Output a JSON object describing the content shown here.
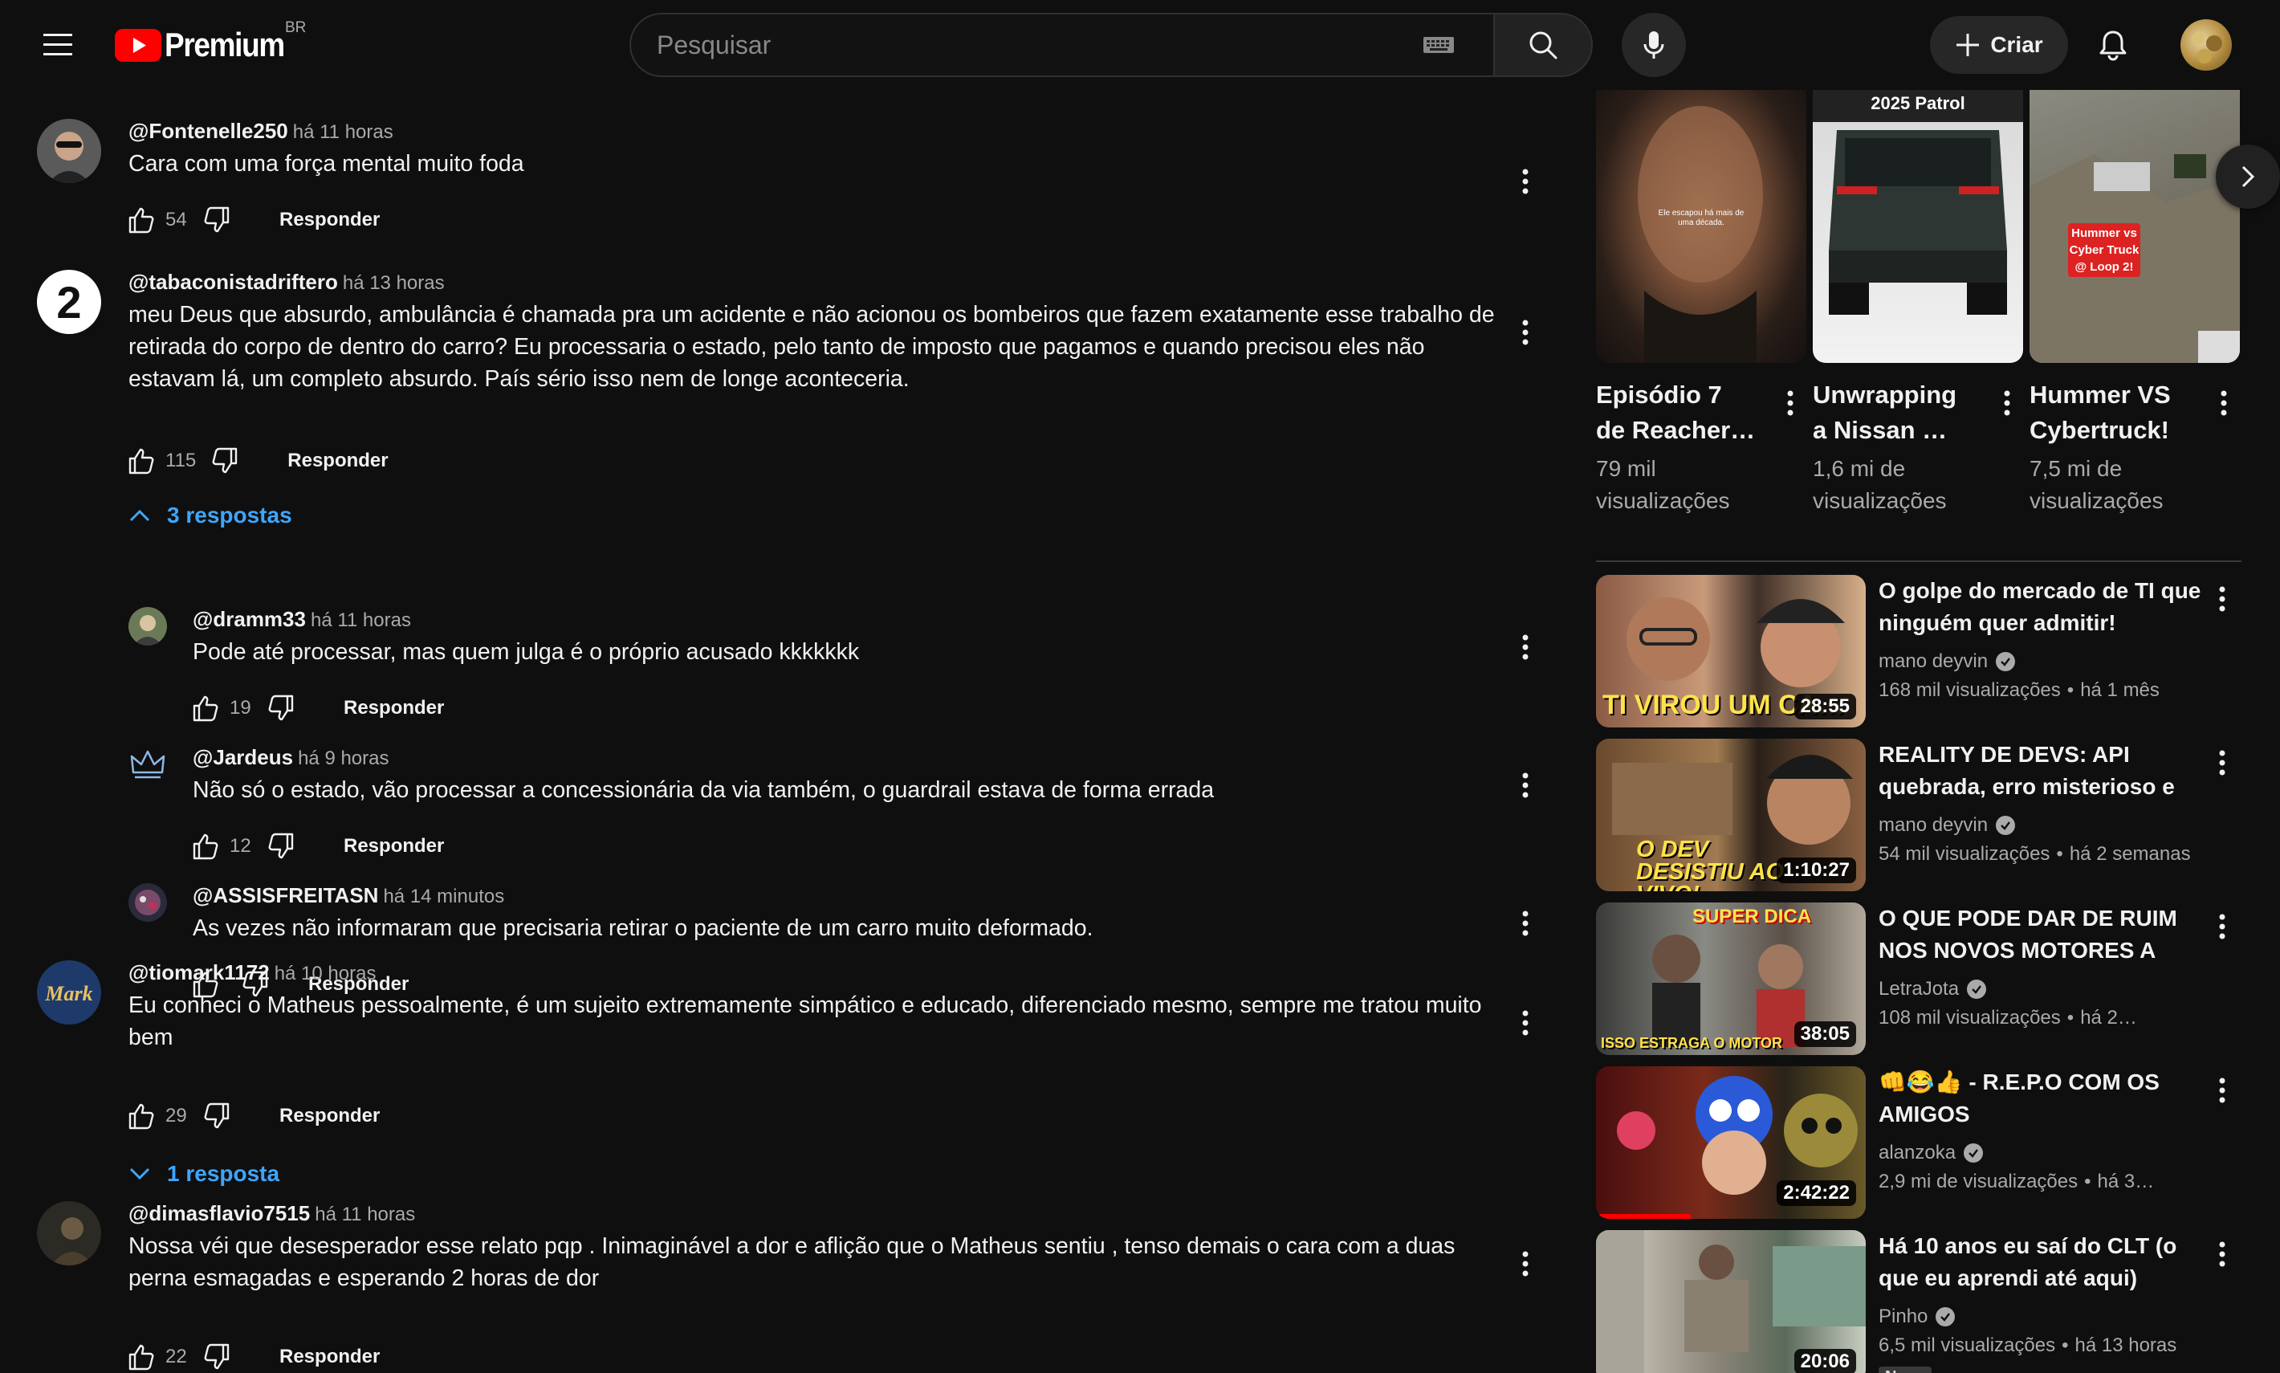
{
  "masthead": {
    "logo_text": "Premium",
    "region": "BR",
    "search_placeholder": "Pesquisar",
    "create_label": "Criar"
  },
  "comments": [
    {
      "author": "@Fontenelle250",
      "time": "há 11 horas",
      "text": "Cara com uma força mental muito foda",
      "likes": "54",
      "reply_label": "Responder"
    },
    {
      "author": "@tabaconistadriftero",
      "time": "há 13 horas",
      "text": "meu Deus que absurdo, ambulância é chamada pra um acidente e não acionou os bombeiros que fazem exatamente esse trabalho de retirada do corpo de dentro do carro? Eu processaria o estado, pelo tanto de imposto que pagamos e quando precisou eles não estavam lá, um completo absurdo. País sério isso nem de longe aconteceria.",
      "likes": "115",
      "reply_label": "Responder",
      "replies_toggle": "3 respostas",
      "avatar_text": "2",
      "replies": [
        {
          "author": "@dramm33",
          "time": "há 11 horas",
          "text": "Pode até processar, mas quem julga é o próprio acusado kkkkkkk",
          "likes": "19",
          "reply_label": "Responder"
        },
        {
          "author": "@Jardeus",
          "time": "há 9 horas",
          "text": "Não só o estado, vão processar a concessionária da via também, o guardrail estava de forma errada",
          "likes": "12",
          "reply_label": "Responder"
        },
        {
          "author": "@ASSISFREITASN",
          "time": "há 14 minutos",
          "text": "As vezes não informaram que precisaria retirar o paciente de um carro muito deformado.",
          "likes": "",
          "reply_label": "Responder"
        }
      ]
    },
    {
      "author": "@tiomark1172",
      "time": "há 10 horas",
      "text": "Eu conheci o Matheus pessoalmente, é um sujeito extremamente simpático e educado, diferenciado mesmo, sempre me tratou muito bem",
      "likes": "29",
      "reply_label": "Responder",
      "replies_toggle": "1 resposta"
    },
    {
      "author": "@dimasflavio7515",
      "time": "há 11 horas",
      "text": "Nossa véi que desesperador esse relato pqp . Inimaginável a dor e aflição que o Matheus sentiu , tenso demais o cara com a duas perna esmagadas e esperando 2 horas de dor",
      "likes": "22",
      "reply_label": "Responder"
    }
  ],
  "shorts": [
    {
      "title": "Episódio 7 de Reacher…",
      "views": "79 mil visualizações",
      "thumb_caption": "Ele escapou há mais de uma década."
    },
    {
      "title": "Unwrapping a Nissan …",
      "views": "1,6 mi de visualizações",
      "thumb_caption": "2025 Patrol"
    },
    {
      "title": "Hummer VS Cybertruck!",
      "views": "7,5 mi de visualizações",
      "thumb_caption": "Hummer vs Cyber Truck @ Loop 2!"
    }
  ],
  "videos": [
    {
      "title": "O golpe do mercado de TI que ninguém quer admitir!",
      "channel": "mano deyvin",
      "views": "168 mil visualizações",
      "age": "há 1 mês",
      "duration": "28:55",
      "thumb_caption": "TI VIROU UM CA…"
    },
    {
      "title": "REALITY DE DEVS: API quebrada, erro misterioso e o…",
      "channel": "mano deyvin",
      "views": "54 mil visualizações",
      "age": "há 2 semanas",
      "duration": "1:10:27",
      "thumb_caption": "O DEV DESISTIU AO VIVO!"
    },
    {
      "title": "O QUE PODE DAR DE RUIM NOS NOVOS MOTORES A DIESEL?…",
      "channel": "LetraJota",
      "views": "108 mil visualizações",
      "age": "há 2…",
      "duration": "38:05",
      "thumb_caption": "SUPER DICA",
      "thumb_caption2": "ISSO ESTRAGA O MOTOR"
    },
    {
      "title": "👊😂👍 - R.E.P.O COM OS AMIGOS",
      "channel": "alanzoka",
      "views": "2,9 mi de visualizações",
      "age": "há 3…",
      "duration": "2:42:22",
      "progress": 0.35
    },
    {
      "title": "Há 10 anos eu saí do CLT (o que eu aprendi até aqui)",
      "channel": "Pinho",
      "views": "6,5 mil visualizações",
      "age": "há 13 horas",
      "duration": "20:06",
      "badge": "Novo"
    }
  ]
}
